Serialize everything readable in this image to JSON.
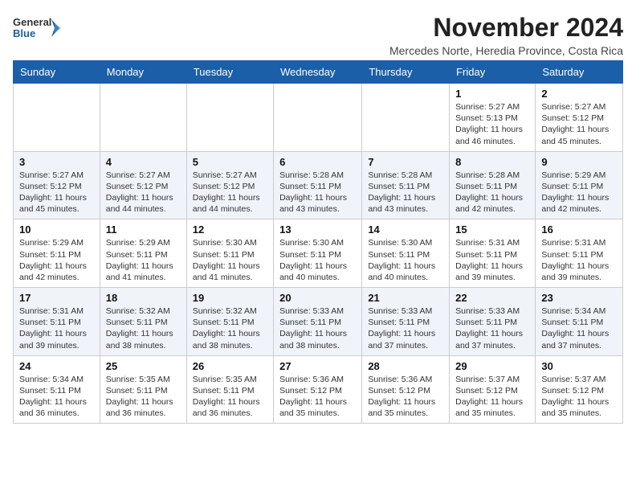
{
  "logo": {
    "line1": "General",
    "line2": "Blue"
  },
  "title": "November 2024",
  "location": "Mercedes Norte, Heredia Province, Costa Rica",
  "days_of_week": [
    "Sunday",
    "Monday",
    "Tuesday",
    "Wednesday",
    "Thursday",
    "Friday",
    "Saturday"
  ],
  "weeks": [
    [
      {
        "day": "",
        "info": ""
      },
      {
        "day": "",
        "info": ""
      },
      {
        "day": "",
        "info": ""
      },
      {
        "day": "",
        "info": ""
      },
      {
        "day": "",
        "info": ""
      },
      {
        "day": "1",
        "info": "Sunrise: 5:27 AM\nSunset: 5:13 PM\nDaylight: 11 hours and 46 minutes."
      },
      {
        "day": "2",
        "info": "Sunrise: 5:27 AM\nSunset: 5:12 PM\nDaylight: 11 hours and 45 minutes."
      }
    ],
    [
      {
        "day": "3",
        "info": "Sunrise: 5:27 AM\nSunset: 5:12 PM\nDaylight: 11 hours and 45 minutes."
      },
      {
        "day": "4",
        "info": "Sunrise: 5:27 AM\nSunset: 5:12 PM\nDaylight: 11 hours and 44 minutes."
      },
      {
        "day": "5",
        "info": "Sunrise: 5:27 AM\nSunset: 5:12 PM\nDaylight: 11 hours and 44 minutes."
      },
      {
        "day": "6",
        "info": "Sunrise: 5:28 AM\nSunset: 5:11 PM\nDaylight: 11 hours and 43 minutes."
      },
      {
        "day": "7",
        "info": "Sunrise: 5:28 AM\nSunset: 5:11 PM\nDaylight: 11 hours and 43 minutes."
      },
      {
        "day": "8",
        "info": "Sunrise: 5:28 AM\nSunset: 5:11 PM\nDaylight: 11 hours and 42 minutes."
      },
      {
        "day": "9",
        "info": "Sunrise: 5:29 AM\nSunset: 5:11 PM\nDaylight: 11 hours and 42 minutes."
      }
    ],
    [
      {
        "day": "10",
        "info": "Sunrise: 5:29 AM\nSunset: 5:11 PM\nDaylight: 11 hours and 42 minutes."
      },
      {
        "day": "11",
        "info": "Sunrise: 5:29 AM\nSunset: 5:11 PM\nDaylight: 11 hours and 41 minutes."
      },
      {
        "day": "12",
        "info": "Sunrise: 5:30 AM\nSunset: 5:11 PM\nDaylight: 11 hours and 41 minutes."
      },
      {
        "day": "13",
        "info": "Sunrise: 5:30 AM\nSunset: 5:11 PM\nDaylight: 11 hours and 40 minutes."
      },
      {
        "day": "14",
        "info": "Sunrise: 5:30 AM\nSunset: 5:11 PM\nDaylight: 11 hours and 40 minutes."
      },
      {
        "day": "15",
        "info": "Sunrise: 5:31 AM\nSunset: 5:11 PM\nDaylight: 11 hours and 39 minutes."
      },
      {
        "day": "16",
        "info": "Sunrise: 5:31 AM\nSunset: 5:11 PM\nDaylight: 11 hours and 39 minutes."
      }
    ],
    [
      {
        "day": "17",
        "info": "Sunrise: 5:31 AM\nSunset: 5:11 PM\nDaylight: 11 hours and 39 minutes."
      },
      {
        "day": "18",
        "info": "Sunrise: 5:32 AM\nSunset: 5:11 PM\nDaylight: 11 hours and 38 minutes."
      },
      {
        "day": "19",
        "info": "Sunrise: 5:32 AM\nSunset: 5:11 PM\nDaylight: 11 hours and 38 minutes."
      },
      {
        "day": "20",
        "info": "Sunrise: 5:33 AM\nSunset: 5:11 PM\nDaylight: 11 hours and 38 minutes."
      },
      {
        "day": "21",
        "info": "Sunrise: 5:33 AM\nSunset: 5:11 PM\nDaylight: 11 hours and 37 minutes."
      },
      {
        "day": "22",
        "info": "Sunrise: 5:33 AM\nSunset: 5:11 PM\nDaylight: 11 hours and 37 minutes."
      },
      {
        "day": "23",
        "info": "Sunrise: 5:34 AM\nSunset: 5:11 PM\nDaylight: 11 hours and 37 minutes."
      }
    ],
    [
      {
        "day": "24",
        "info": "Sunrise: 5:34 AM\nSunset: 5:11 PM\nDaylight: 11 hours and 36 minutes."
      },
      {
        "day": "25",
        "info": "Sunrise: 5:35 AM\nSunset: 5:11 PM\nDaylight: 11 hours and 36 minutes."
      },
      {
        "day": "26",
        "info": "Sunrise: 5:35 AM\nSunset: 5:11 PM\nDaylight: 11 hours and 36 minutes."
      },
      {
        "day": "27",
        "info": "Sunrise: 5:36 AM\nSunset: 5:12 PM\nDaylight: 11 hours and 35 minutes."
      },
      {
        "day": "28",
        "info": "Sunrise: 5:36 AM\nSunset: 5:12 PM\nDaylight: 11 hours and 35 minutes."
      },
      {
        "day": "29",
        "info": "Sunrise: 5:37 AM\nSunset: 5:12 PM\nDaylight: 11 hours and 35 minutes."
      },
      {
        "day": "30",
        "info": "Sunrise: 5:37 AM\nSunset: 5:12 PM\nDaylight: 11 hours and 35 minutes."
      }
    ]
  ]
}
